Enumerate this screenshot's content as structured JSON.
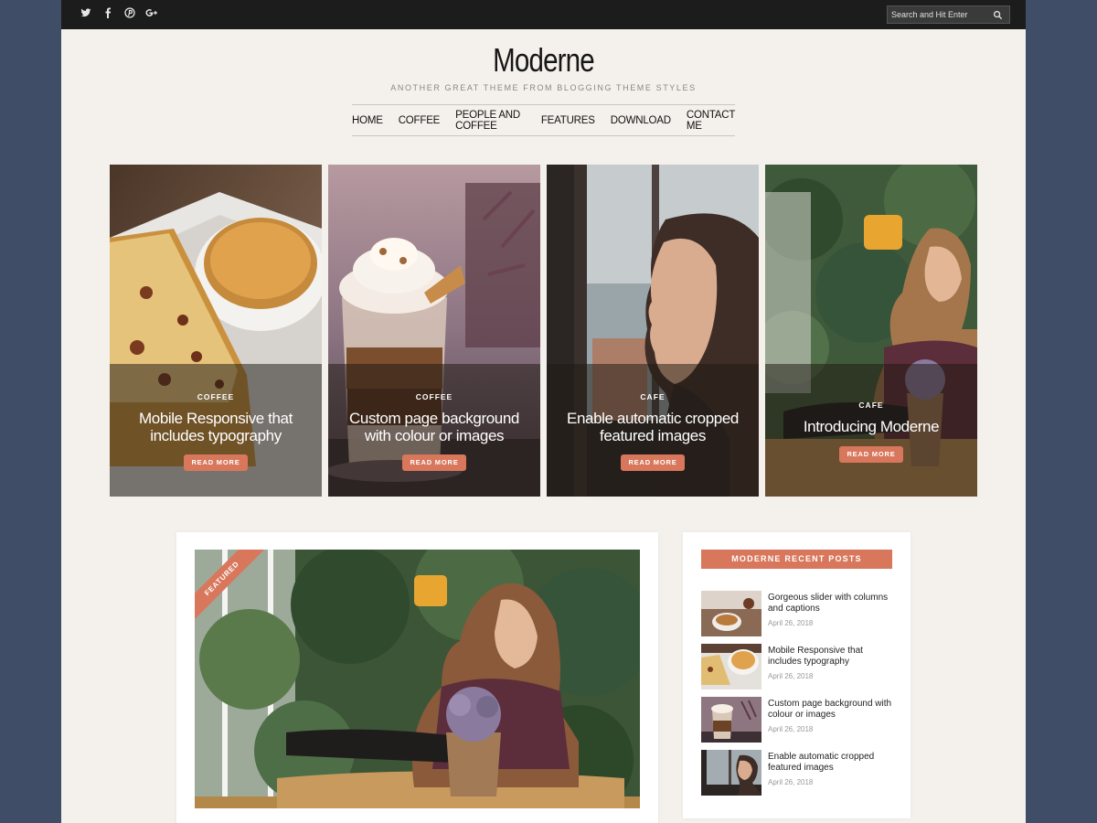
{
  "topbar": {
    "social": [
      {
        "name": "twitter-icon",
        "glyph": "🐦"
      },
      {
        "name": "facebook-icon",
        "glyph": "f"
      },
      {
        "name": "pinterest-icon",
        "glyph": "℗"
      },
      {
        "name": "google-plus-icon",
        "glyph": "G+"
      }
    ],
    "search_placeholder": "Search and Hit Enter"
  },
  "header": {
    "title": "Moderne",
    "tagline": "ANOTHER GREAT THEME FROM BLOGGING THEME STYLES"
  },
  "nav": {
    "items": [
      "HOME",
      "COFFEE",
      "PEOPLE AND COFFEE",
      "FEATURES",
      "DOWNLOAD",
      "CONTACT ME"
    ]
  },
  "slider": {
    "tiles": [
      {
        "category": "COFFEE",
        "title": "Mobile Responsive that includes typography",
        "button": "READ MORE"
      },
      {
        "category": "COFFEE",
        "title": "Custom page background with colour or images",
        "button": "READ MORE"
      },
      {
        "category": "CAFE",
        "title": "Enable automatic cropped featured images",
        "button": "READ MORE"
      },
      {
        "category": "CAFE",
        "title": "Introducing Moderne",
        "button": "READ MORE"
      }
    ]
  },
  "post": {
    "badge": "FEATURED"
  },
  "sidebar": {
    "widget_title": "MODERNE RECENT POSTS",
    "posts": [
      {
        "title": "Gorgeous slider with columns and captions",
        "date": "April 26, 2018"
      },
      {
        "title": "Mobile Responsive that includes typography",
        "date": "April 26, 2018"
      },
      {
        "title": "Custom page background with colour or images",
        "date": "April 26, 2018"
      },
      {
        "title": "Enable automatic cropped featured images",
        "date": "April 26, 2018"
      }
    ]
  },
  "colors": {
    "accent": "#d8775c",
    "page_bg": "#f4f1ec",
    "outer_bg": "#3f4d67",
    "topbar_bg": "#1c1c1c"
  }
}
